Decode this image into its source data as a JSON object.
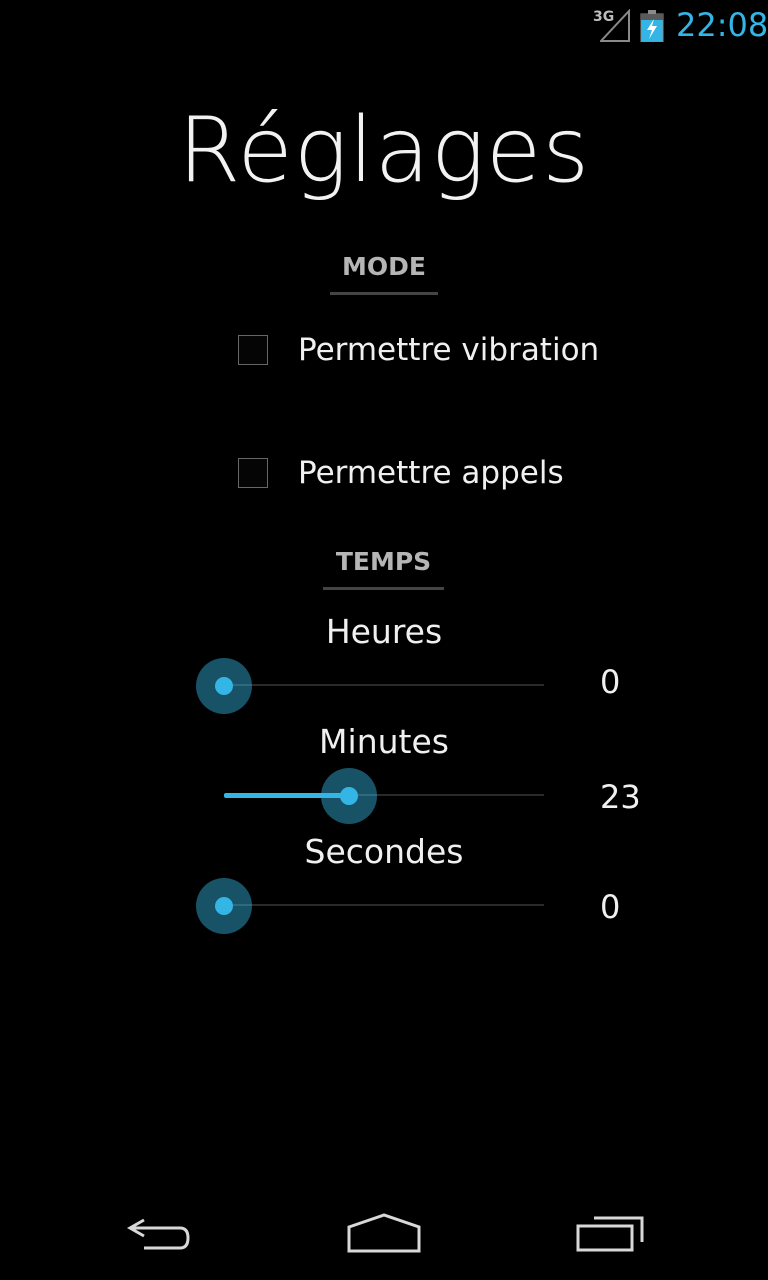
{
  "status_bar": {
    "network": "3G",
    "time": "22:08",
    "icons": [
      "signal-icon",
      "battery-charging-icon"
    ],
    "accent_color": "#33b5e5"
  },
  "page": {
    "title": "Réglages"
  },
  "mode_section": {
    "header": "MODE",
    "options": [
      {
        "label": "Permettre vibration",
        "checked": false
      },
      {
        "label": "Permettre appels",
        "checked": false
      }
    ]
  },
  "temps_section": {
    "header": "TEMPS",
    "sliders": [
      {
        "label": "Heures",
        "value": "0",
        "fraction": 0.0
      },
      {
        "label": "Minutes",
        "value": "23",
        "fraction": 0.39
      },
      {
        "label": "Secondes",
        "value": "0",
        "fraction": 0.0
      }
    ]
  },
  "nav_bar": {
    "icons": [
      "back-icon",
      "home-icon",
      "recent-apps-icon"
    ]
  }
}
